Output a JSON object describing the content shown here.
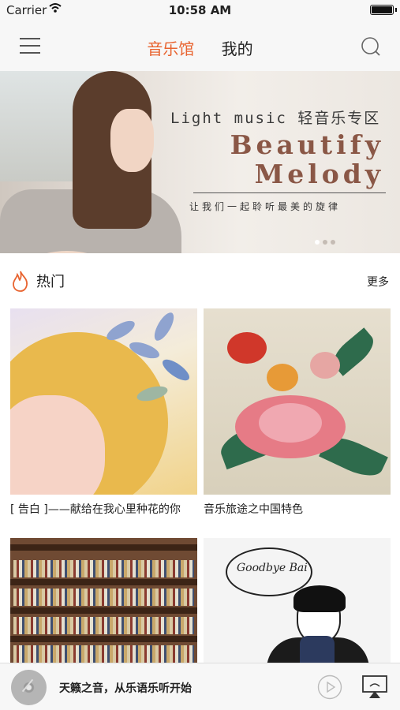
{
  "status_bar": {
    "carrier": "Carrier",
    "time": "10:58 AM"
  },
  "nav": {
    "tabs": [
      {
        "label": "音乐馆",
        "active": true
      },
      {
        "label": "我的",
        "active": false
      }
    ],
    "icons": {
      "menu": "hamburger-menu-icon",
      "search": "search-icon"
    },
    "accent_color": "#e8632f"
  },
  "banner": {
    "subtitle": "Light music 轻音乐专区",
    "title_line1": "Beautify",
    "title_line2": "Melody",
    "tagline": "让我们一起聆听最美的旋律",
    "pages": 3,
    "current_page": 1
  },
  "section": {
    "title": "热门",
    "more_label": "更多",
    "icon": "flame-icon"
  },
  "cards": [
    {
      "caption": "[ 告白 ]——献给在我心里种花的你"
    },
    {
      "caption": "音乐旅途之中国特色"
    },
    {
      "caption": ""
    },
    {
      "caption": ""
    }
  ],
  "cover_text": {
    "goodbye": "Goodbye Bai"
  },
  "player": {
    "track_title": "天籁之音，从乐语乐听开始",
    "icons": {
      "disc": "album-disc-icon",
      "play": "play-icon",
      "airplay": "airplay-icon"
    }
  }
}
